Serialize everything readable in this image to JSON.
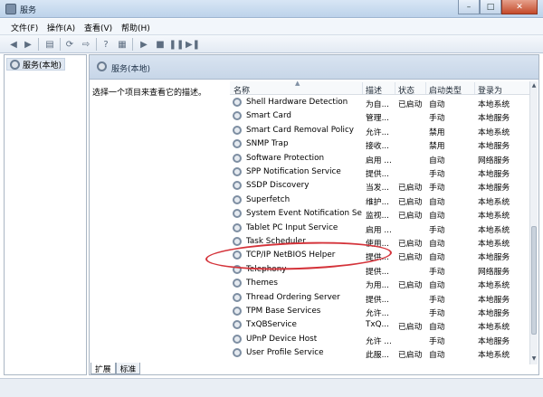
{
  "window": {
    "title": "服务"
  },
  "menu": [
    "文件(F)",
    "操作(A)",
    "查看(V)",
    "帮助(H)"
  ],
  "tree": {
    "root": "服务(本地)"
  },
  "panel": {
    "header": "服务(本地)",
    "description": "选择一个项目来查看它的描述。"
  },
  "columns": [
    "名称",
    "描述",
    "状态",
    "启动类型",
    "登录为"
  ],
  "services": [
    [
      "Shell Hardware Detection",
      "为自...",
      "已启动",
      "自动",
      "本地系统"
    ],
    [
      "Smart Card",
      "管理...",
      "",
      "手动",
      "本地服务"
    ],
    [
      "Smart Card Removal Policy",
      "允许...",
      "",
      "禁用",
      "本地系统"
    ],
    [
      "SNMP Trap",
      "接收...",
      "",
      "禁用",
      "本地服务"
    ],
    [
      "Software Protection",
      "启用 ...",
      "",
      "自动",
      "网络服务"
    ],
    [
      "SPP Notification Service",
      "提供...",
      "",
      "手动",
      "本地服务"
    ],
    [
      "SSDP Discovery",
      "当发...",
      "已启动",
      "手动",
      "本地服务"
    ],
    [
      "Superfetch",
      "维护...",
      "已启动",
      "自动",
      "本地系统"
    ],
    [
      "System Event Notification Se...",
      "监视...",
      "已启动",
      "自动",
      "本地系统"
    ],
    [
      "Tablet PC Input Service",
      "启用 ...",
      "",
      "手动",
      "本地系统"
    ],
    [
      "Task Scheduler",
      "使用...",
      "已启动",
      "自动",
      "本地系统"
    ],
    [
      "TCP/IP NetBIOS Helper",
      "提供...",
      "已启动",
      "自动",
      "本地服务"
    ],
    [
      "Telephony",
      "提供...",
      "",
      "手动",
      "网络服务"
    ],
    [
      "Themes",
      "为用...",
      "已启动",
      "自动",
      "本地系统"
    ],
    [
      "Thread Ordering Server",
      "提供...",
      "",
      "手动",
      "本地服务"
    ],
    [
      "TPM Base Services",
      "允许...",
      "",
      "手动",
      "本地服务"
    ],
    [
      "TxQBService",
      "TxQ...",
      "已启动",
      "自动",
      "本地系统"
    ],
    [
      "UPnP Device Host",
      "允许 ...",
      "",
      "手动",
      "本地服务"
    ],
    [
      "User Profile Service",
      "此服...",
      "已启动",
      "自动",
      "本地系统"
    ]
  ],
  "tabs": [
    "扩展",
    "标准"
  ],
  "annotation_color": "#d4333a"
}
